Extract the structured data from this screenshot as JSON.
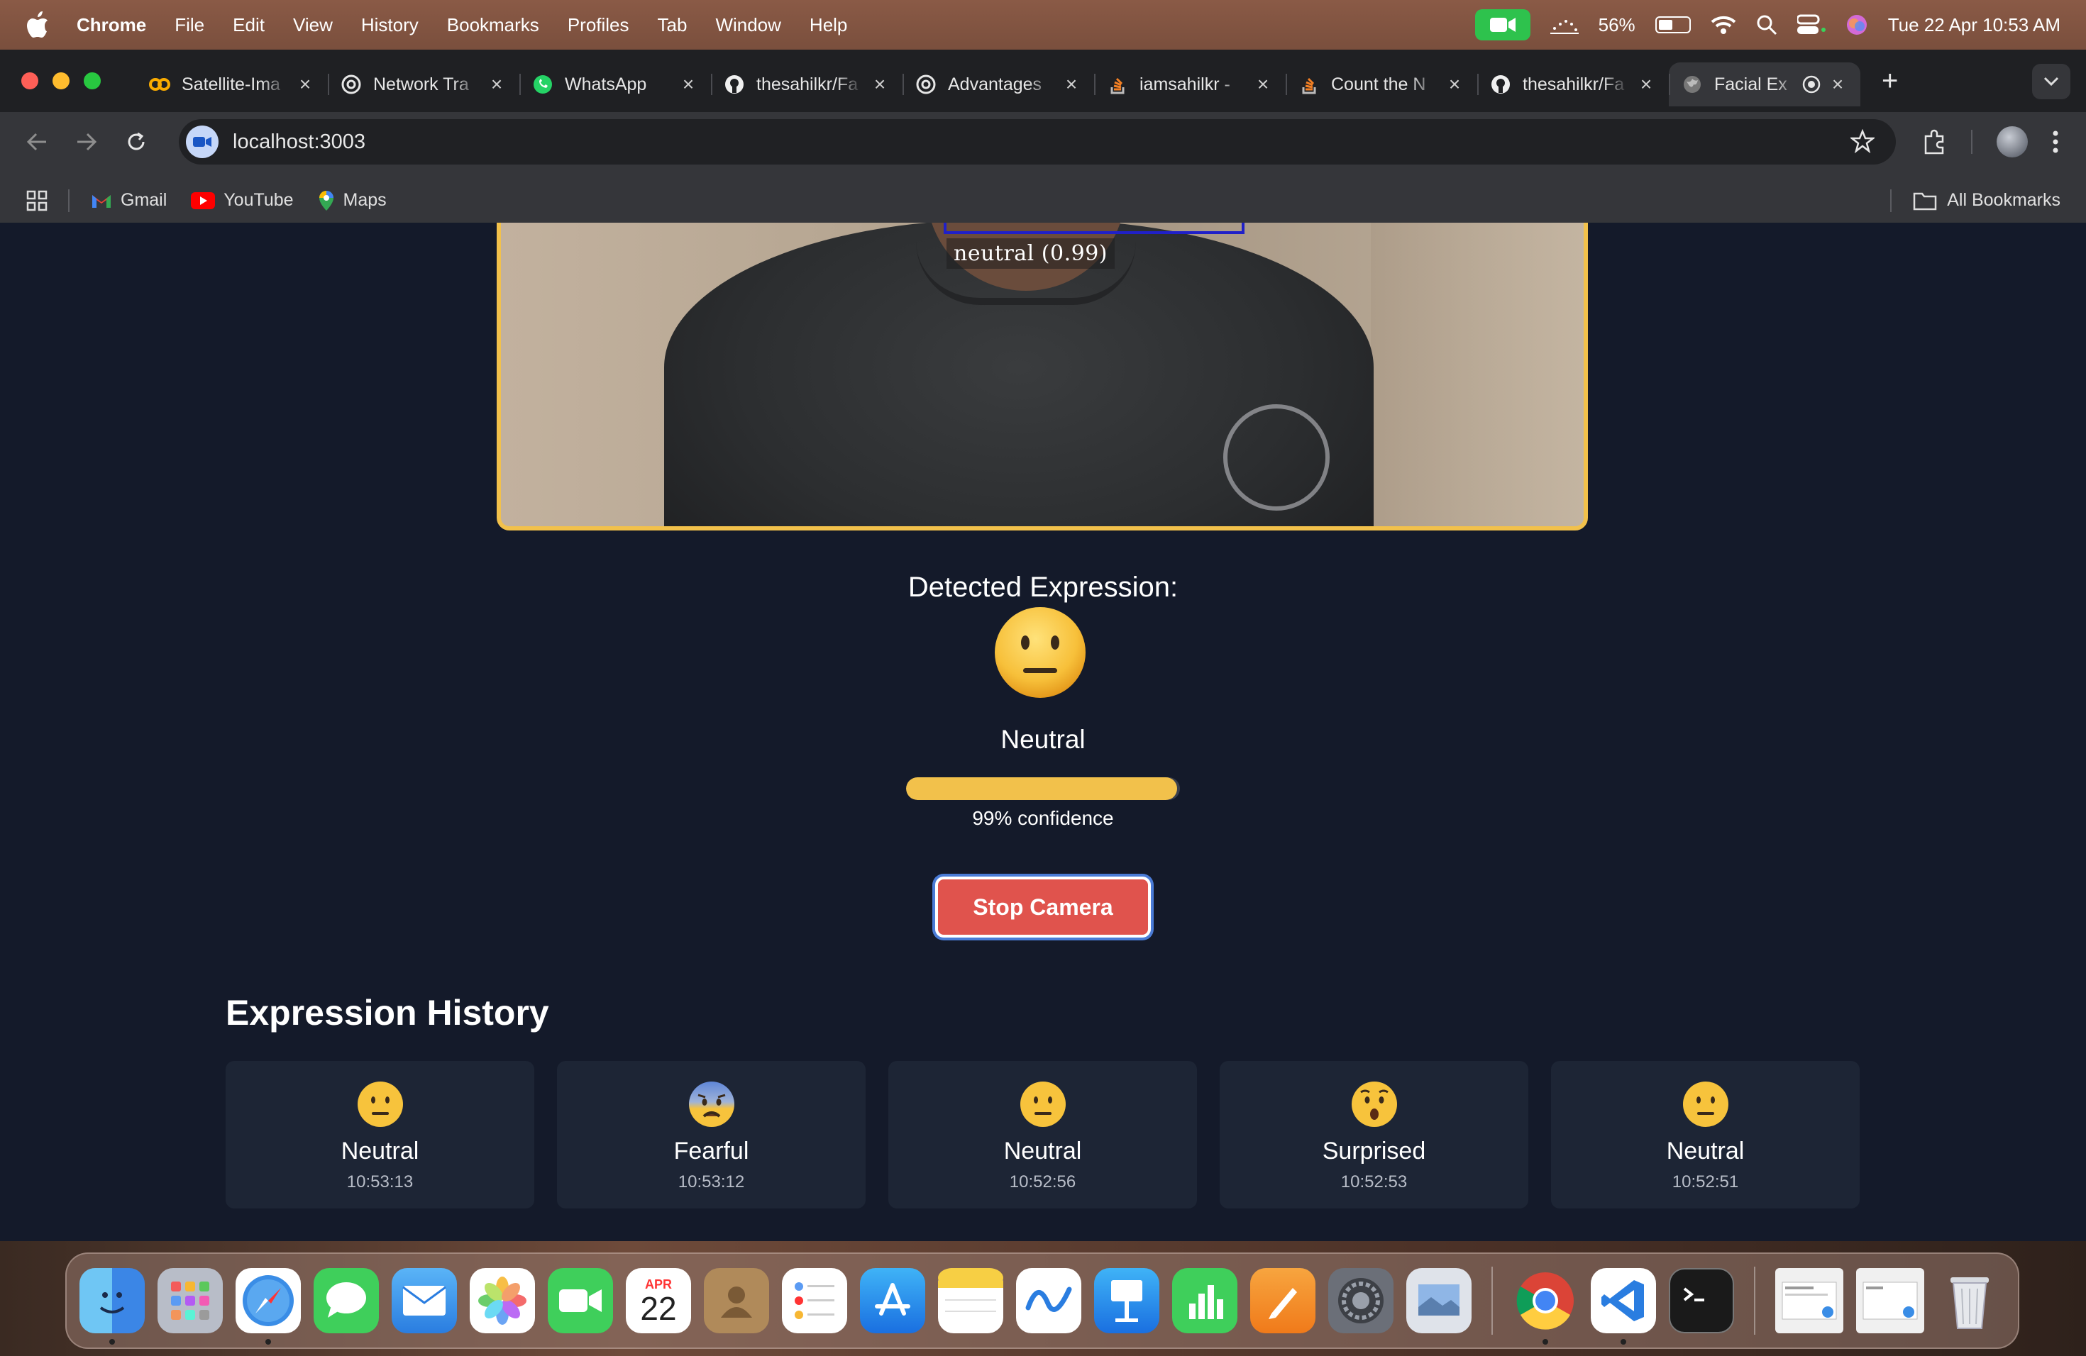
{
  "menubar": {
    "app_name": "Chrome",
    "items": [
      "File",
      "Edit",
      "View",
      "History",
      "Bookmarks",
      "Profiles",
      "Tab",
      "Window",
      "Help"
    ],
    "battery_percent": "56%",
    "battery_level": 0.56,
    "datetime": "Tue 22 Apr  10:53 AM"
  },
  "tabs": [
    {
      "title": "Satellite-Ima",
      "icon": "colab-icon"
    },
    {
      "title": "Network Tra",
      "icon": "openai-icon"
    },
    {
      "title": "WhatsApp",
      "icon": "whatsapp-icon"
    },
    {
      "title": "thesahilkr/Fa",
      "icon": "github-icon"
    },
    {
      "title": "Advantages",
      "icon": "openai-icon"
    },
    {
      "title": "iamsahilkr -",
      "icon": "stackoverflow-icon"
    },
    {
      "title": "Count the N",
      "icon": "stackoverflow-icon"
    },
    {
      "title": "thesahilkr/Fa",
      "icon": "github-icon"
    },
    {
      "title": "Facial Ex",
      "icon": "globe-icon",
      "active": true
    }
  ],
  "address_bar": {
    "url": "localhost:3003"
  },
  "bookmarks": {
    "items": [
      {
        "label": "Gmail",
        "icon": "gmail-icon"
      },
      {
        "label": "YouTube",
        "icon": "youtube-icon"
      },
      {
        "label": "Maps",
        "icon": "maps-icon"
      }
    ],
    "all_bookmarks": "All Bookmarks"
  },
  "video": {
    "face_label": "neutral (0.99)",
    "border_color": "#f2c14b"
  },
  "detection": {
    "title": "Detected Expression:",
    "expression": "Neutral",
    "confidence": 0.99,
    "confidence_text": "99% confidence"
  },
  "controls": {
    "stop_label": "Stop Camera"
  },
  "history": {
    "title": "Expression History",
    "items": [
      {
        "expression": "Neutral",
        "time": "10:53:13",
        "emoji": "neutral"
      },
      {
        "expression": "Fearful",
        "time": "10:53:12",
        "emoji": "fearful"
      },
      {
        "expression": "Neutral",
        "time": "10:52:56",
        "emoji": "neutral"
      },
      {
        "expression": "Surprised",
        "time": "10:52:53",
        "emoji": "surprised"
      },
      {
        "expression": "Neutral",
        "time": "10:52:51",
        "emoji": "neutral"
      }
    ]
  },
  "calendar_dock": {
    "month": "APR",
    "day": "22"
  },
  "colors": {
    "page_bg": "#141a2a",
    "card_bg": "#1d2535",
    "accent_yellow": "#f2c14b",
    "stop_red": "#e0534d"
  }
}
